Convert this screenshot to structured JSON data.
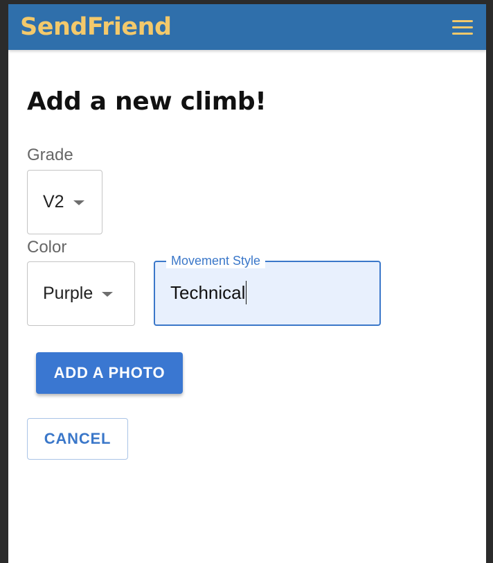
{
  "app": {
    "brand": "SendFriend",
    "menu_icon": "hamburger-menu-icon"
  },
  "colors": {
    "appbar": "#2f6fab",
    "brand_text": "#f3c96b",
    "primary": "#3a77d1",
    "focused_field_bg": "#e8f0fd"
  },
  "page": {
    "title": "Add a new climb!"
  },
  "form": {
    "grade": {
      "label": "Grade",
      "value": "V2"
    },
    "color": {
      "label": "Color",
      "value": "Purple"
    },
    "movement_style": {
      "label": "Movement Style",
      "value": "Technical"
    }
  },
  "actions": {
    "add_photo": "ADD A PHOTO",
    "cancel": "CANCEL"
  }
}
